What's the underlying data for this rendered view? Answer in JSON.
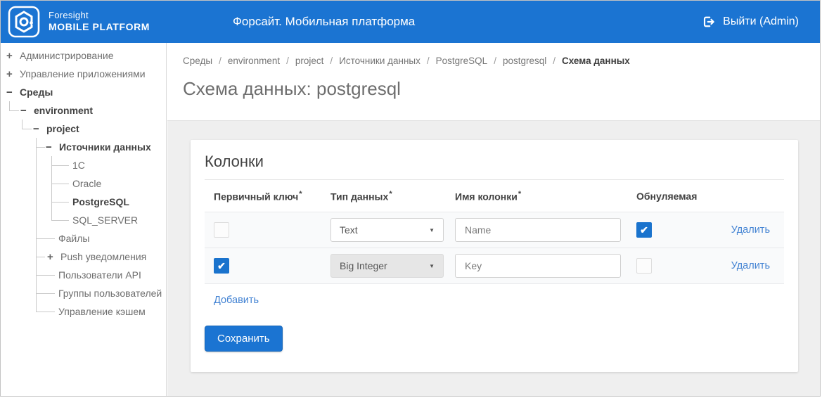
{
  "header": {
    "brand_top": "Foresight",
    "brand_bottom": "MOBILE PLATFORM",
    "app_title": "Форсайт. Мобильная платформа",
    "logout_label": "Выйти (Admin)"
  },
  "sidebar": {
    "items": [
      {
        "label": "Администрирование",
        "level": 0,
        "toggle": "plus",
        "bold": false
      },
      {
        "label": "Управление приложениями",
        "level": 0,
        "toggle": "plus",
        "bold": false
      },
      {
        "label": "Среды",
        "level": 0,
        "toggle": "minus",
        "bold": true
      },
      {
        "label": "environment",
        "level": 1,
        "toggle": "minus",
        "bold": true
      },
      {
        "label": "project",
        "level": 2,
        "toggle": "minus",
        "bold": true
      },
      {
        "label": "Источники данных",
        "level": 3,
        "toggle": "minus",
        "bold": true
      },
      {
        "label": "1C",
        "level": 4,
        "toggle": null,
        "bold": false
      },
      {
        "label": "Oracle",
        "level": 4,
        "toggle": null,
        "bold": false
      },
      {
        "label": "PostgreSQL",
        "level": 4,
        "toggle": null,
        "bold": true
      },
      {
        "label": "SQL_SERVER",
        "level": 4,
        "toggle": null,
        "bold": false
      },
      {
        "label": "Файлы",
        "level": 3,
        "toggle": null,
        "bold": false
      },
      {
        "label": "Push уведомления",
        "level": 3,
        "toggle": "plus",
        "bold": false
      },
      {
        "label": "Пользователи API",
        "level": 3,
        "toggle": null,
        "bold": false
      },
      {
        "label": "Группы пользователей",
        "level": 3,
        "toggle": null,
        "bold": false
      },
      {
        "label": "Управление кэшем",
        "level": 3,
        "toggle": null,
        "bold": false
      }
    ]
  },
  "breadcrumb": {
    "separator": "/",
    "items": [
      "Среды",
      "environment",
      "project",
      "Источники данных",
      "PostgreSQL",
      "postgresql",
      "Схема данных"
    ]
  },
  "page": {
    "title": "Схема данных: postgresql"
  },
  "card": {
    "title": "Колонки",
    "table": {
      "headers": [
        {
          "label": "Первичный ключ",
          "required": true
        },
        {
          "label": "Тип данных",
          "required": true
        },
        {
          "label": "Имя колонки",
          "required": true
        },
        {
          "label": "Обнуляемая",
          "required": false
        }
      ],
      "rows": [
        {
          "primary_key": false,
          "data_type": "Text",
          "type_disabled": false,
          "column_name": "Name",
          "nullable": true,
          "delete_label": "Удалить"
        },
        {
          "primary_key": true,
          "data_type": "Big Integer",
          "type_disabled": true,
          "column_name": "Key",
          "nullable": false,
          "delete_label": "Удалить"
        }
      ]
    },
    "add_label": "Добавить",
    "save_label": "Сохранить"
  },
  "icons": {
    "logo": "foresight-logo-icon",
    "logout": "logout-icon",
    "select_arrow": "chevron-down-icon",
    "check": "✔",
    "dropdown_glyph": "▼"
  },
  "colors": {
    "header_blue": "#1b74d2",
    "checkbox_blue": "#1a73cd",
    "link_blue": "#4383d3",
    "row_bg": "#f9fafb"
  }
}
